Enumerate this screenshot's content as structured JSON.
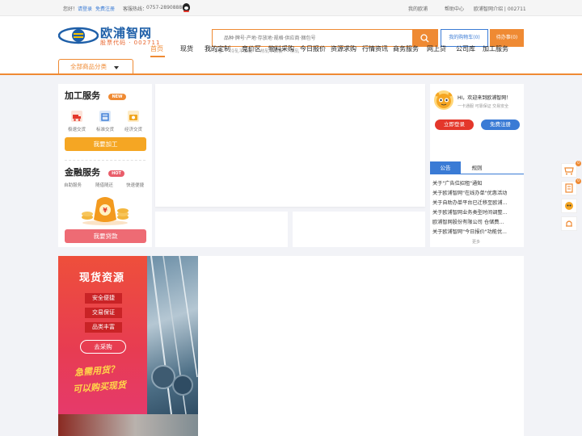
{
  "topbar": {
    "greeting": "您好！",
    "login": "请登录",
    "register": "免费注册",
    "hotline_label": "客服热线：",
    "hotline": "0757-28908888",
    "my_oupu": "我的欧浦",
    "help": "帮助中心",
    "intro": "欧浦智网介绍 | 002711"
  },
  "logo": {
    "title": "欧浦智网",
    "subtitle": "股票代码 · 002711"
  },
  "search": {
    "placeholder": "品种·牌号·产地·存放地·规格·供应商·捆包号",
    "hot_words": [
      "冷卷",
      "冷轧平面板",
      "热轧平面板",
      "热轧"
    ]
  },
  "header_buttons": {
    "cart": "我的购物车(0)",
    "orders": "待办事(0)"
  },
  "nav": {
    "category": "全部商品分类",
    "items": [
      "首页",
      "现货",
      "我的定制",
      "竞价区",
      "物料采购",
      "今日报价",
      "资源求购",
      "行情资讯",
      "商务服务",
      "网上贷",
      "公司库",
      "加工服务"
    ]
  },
  "processing": {
    "title": "加工服务",
    "badge": "NEW",
    "icons": [
      {
        "label": "极速交货",
        "icon": "truck-icon"
      },
      {
        "label": "标准交货",
        "icon": "box-icon"
      },
      {
        "label": "经济交货",
        "icon": "coin-icon"
      }
    ],
    "button": "我要加工"
  },
  "finance": {
    "title": "金融服务",
    "badge": "HOT",
    "items": [
      "自助服务",
      "随借随还",
      "快速便捷"
    ],
    "button": "我要贷款"
  },
  "user": {
    "greeting": "HI，欢迎来到欧浦智网！",
    "slogan": "一卡通服 可靠保证 交易安全",
    "login": "立即登录",
    "register": "免费注册"
  },
  "tabs": [
    "公告",
    "规则"
  ],
  "notices": [
    "关于\"广告位招租\"通知",
    "关于欧浦智网\"在线办单\"优惠活动",
    "关于自助办单平台已迁移至欧浦...",
    "关于欧浦智网业务类型时间调整...",
    "欧浦智网股份有限公司 仓储费...",
    "关于欧浦智网\"今日报价\"功能优..."
  ],
  "more": "更多",
  "promo": {
    "title": "现货资源",
    "tags": [
      "安全便捷",
      "交易保证",
      "品类丰富"
    ],
    "button": "去采购",
    "script_line1": "急需用货？",
    "script_line2": "可以购买现货"
  },
  "float_bar": {
    "cart_count": "0",
    "list_count": "0"
  },
  "colors": {
    "accent": "#ef8a33",
    "brand_blue": "#3a7bd5",
    "red": "#e4372b"
  }
}
